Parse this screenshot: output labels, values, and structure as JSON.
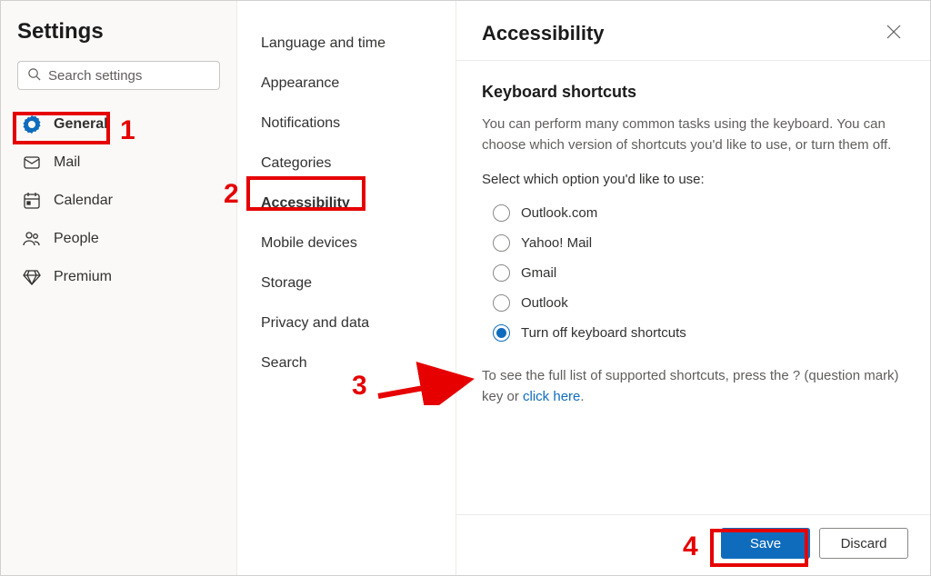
{
  "sidebar": {
    "title": "Settings",
    "search_placeholder": "Search settings",
    "items": [
      {
        "label": "General"
      },
      {
        "label": "Mail"
      },
      {
        "label": "Calendar"
      },
      {
        "label": "People"
      },
      {
        "label": "Premium"
      }
    ]
  },
  "subnav": {
    "items": [
      {
        "label": "Language and time"
      },
      {
        "label": "Appearance"
      },
      {
        "label": "Notifications"
      },
      {
        "label": "Categories"
      },
      {
        "label": "Accessibility"
      },
      {
        "label": "Mobile devices"
      },
      {
        "label": "Storage"
      },
      {
        "label": "Privacy and data"
      },
      {
        "label": "Search"
      }
    ]
  },
  "content": {
    "title": "Accessibility",
    "section_title": "Keyboard shortcuts",
    "description": "You can perform many common tasks using the keyboard. You can choose which version of shortcuts you'd like to use, or turn them off.",
    "prompt": "Select which option you'd like to use:",
    "options": [
      {
        "label": "Outlook.com"
      },
      {
        "label": "Yahoo! Mail"
      },
      {
        "label": "Gmail"
      },
      {
        "label": "Outlook"
      },
      {
        "label": "Turn off keyboard shortcuts"
      }
    ],
    "hint_prefix": "To see the full list of supported shortcuts, press the ? (question mark) key or ",
    "hint_link": "click here",
    "hint_suffix": "."
  },
  "footer": {
    "save_label": "Save",
    "discard_label": "Discard"
  },
  "annotations": {
    "n1": "1",
    "n2": "2",
    "n3": "3",
    "n4": "4"
  }
}
